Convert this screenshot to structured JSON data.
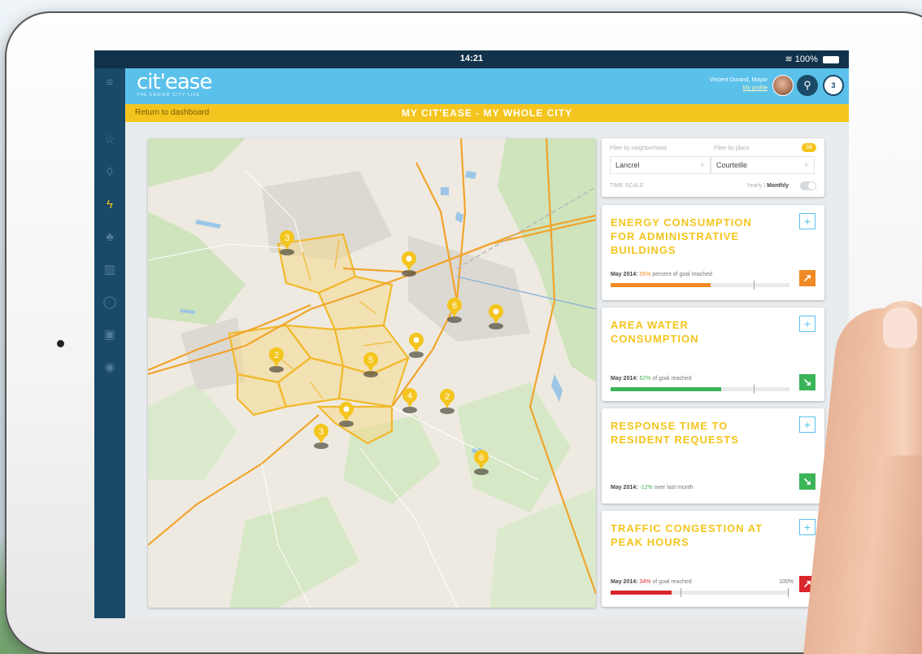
{
  "status_bar": {
    "time": "14:21",
    "battery": "100%"
  },
  "header": {
    "logo": "cit'ease",
    "tagline": "THE EASIER CITY LIFE",
    "user_name": "Vincent Durand, Mayor",
    "profile_link": "My profile",
    "notification_count": "3"
  },
  "titlebar": {
    "back_label": "Return to dashboard",
    "title": "MY CIT'EASE - MY WHOLE CITY"
  },
  "sidebar": {
    "items": [
      {
        "icon": "menu-icon",
        "glyph": "≡"
      },
      {
        "icon": "star-icon",
        "glyph": "☆"
      },
      {
        "icon": "water-drop-icon",
        "glyph": "◊"
      },
      {
        "icon": "energy-bolt-icon",
        "glyph": "ϟ"
      },
      {
        "icon": "tree-icon",
        "glyph": "♣"
      },
      {
        "icon": "building-icon",
        "glyph": "▥"
      },
      {
        "icon": "shield-icon",
        "glyph": "◯"
      },
      {
        "icon": "bus-icon",
        "glyph": "▣"
      },
      {
        "icon": "location-pin-icon",
        "glyph": "◉"
      }
    ]
  },
  "filters": {
    "neighborhood_label": "Filter by neighborhood",
    "place_label": "Filter by place",
    "place_count": "34",
    "neighborhood_value": "Lancrel",
    "place_value": "Courteille",
    "time_scale_label": "TIME SCALE",
    "time_scale_prefix": "Yearly",
    "time_scale_value": "Monthly"
  },
  "map": {
    "markers": [
      {
        "label": "3"
      },
      {
        "label": ""
      },
      {
        "label": "6"
      },
      {
        "label": ""
      },
      {
        "label": ""
      },
      {
        "label": "2"
      },
      {
        "label": "5"
      },
      {
        "label": "4"
      },
      {
        "label": "2"
      },
      {
        "label": ""
      },
      {
        "label": "3"
      },
      {
        "label": "6"
      }
    ]
  },
  "cards": [
    {
      "title": "ENERGY CONSUMPTION FOR ADMINISTRATIVE BUILDINGS",
      "stat_prefix": "May 2014:",
      "stat_value": "56%",
      "stat_suffix": "percent of goal reached",
      "progress": 0.56,
      "trend": "up",
      "color": "#f08a24"
    },
    {
      "title": "AREA WATER CONSUMPTION",
      "stat_prefix": "May 2014:",
      "stat_value": "62%",
      "stat_suffix": "of goal reached",
      "progress": 0.62,
      "trend": "down",
      "color": "#3cb458"
    },
    {
      "title": "RESPONSE TIME TO RESIDENT REQUESTS",
      "stat_prefix": "May 2014:",
      "stat_value": "-12%",
      "stat_suffix": "over last month",
      "trend": "down",
      "color": "#3cb458"
    },
    {
      "title": "TRAFFIC CONGESTION AT PEAK HOURS",
      "stat_prefix": "May 2014:",
      "stat_value": "34%",
      "stat_suffix": "of goal reached",
      "end_label": "100%",
      "progress": 0.34,
      "trend": "up",
      "color": "#d8262c"
    }
  ],
  "colors": {
    "accent_yellow": "#f4c51e",
    "header_blue": "#5bc1ea",
    "sidebar_navy": "#1a4a68"
  }
}
